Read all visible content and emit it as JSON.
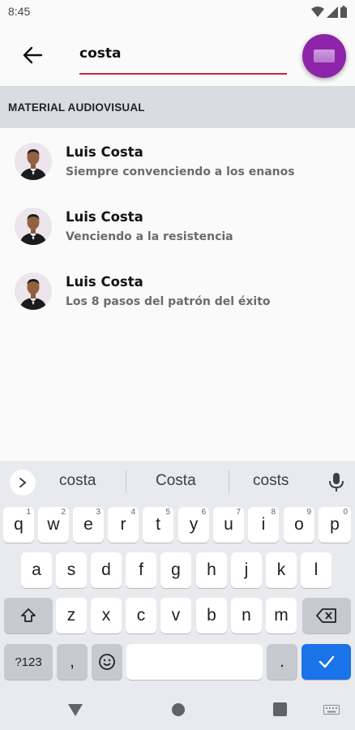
{
  "status": {
    "time": "8:45"
  },
  "search": {
    "value": "costa"
  },
  "section": {
    "title": "MATERIAL AUDIOVISUAL"
  },
  "results": [
    {
      "name": "Luis Costa",
      "subtitle": "Siempre convenciendo a los enanos"
    },
    {
      "name": "Luis Costa",
      "subtitle": "Venciendo a la resistencia"
    },
    {
      "name": "Luis Costa",
      "subtitle": "Los 8 pasos del patrón del éxito"
    }
  ],
  "keyboard": {
    "suggestions": [
      "costa",
      "Costa",
      "costs"
    ],
    "row1": [
      {
        "key": "q",
        "hint": "1"
      },
      {
        "key": "w",
        "hint": "2"
      },
      {
        "key": "e",
        "hint": "3"
      },
      {
        "key": "r",
        "hint": "4"
      },
      {
        "key": "t",
        "hint": "5"
      },
      {
        "key": "y",
        "hint": "6"
      },
      {
        "key": "u",
        "hint": "7"
      },
      {
        "key": "i",
        "hint": "8"
      },
      {
        "key": "o",
        "hint": "9"
      },
      {
        "key": "p",
        "hint": "0"
      }
    ],
    "row2": [
      "a",
      "s",
      "d",
      "f",
      "g",
      "h",
      "j",
      "k",
      "l"
    ],
    "row3": [
      "z",
      "x",
      "c",
      "v",
      "b",
      "n",
      "m"
    ],
    "symbols_label": "?123",
    "comma": ",",
    "period": "."
  },
  "colors": {
    "accent": "#c62838",
    "fab": "#8e24aa",
    "section_bg": "#d9dde1",
    "enter_key": "#1a73e8"
  }
}
